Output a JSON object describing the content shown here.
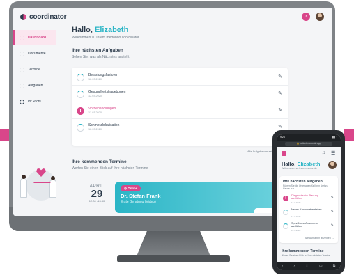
{
  "app": {
    "brand": "coordinator",
    "brand_accent": "#d9468a",
    "secondary_accent": "#2bb5c6",
    "notification_icon": "bell-icon"
  },
  "sidebar": {
    "items": [
      {
        "label": "Dashboard",
        "icon": "dashboard-icon",
        "active": true
      },
      {
        "label": "Dokumente",
        "icon": "document-icon",
        "active": false
      },
      {
        "label": "Termine",
        "icon": "calendar-icon",
        "active": false
      },
      {
        "label": "Aufgaben",
        "icon": "checklist-icon",
        "active": false
      },
      {
        "label": "Ihr Profil",
        "icon": "user-icon",
        "active": false
      }
    ]
  },
  "greeting": {
    "hello": "Hallo,",
    "name": "Elizabeth",
    "welcome": "Willkommen zu Ihrem medondo coordinator"
  },
  "tasks": {
    "title": "Ihre nächsten Aufgaben",
    "subtitle": "Sehen Sie, was als Nächstes ansteht",
    "items": [
      {
        "name": "Belastungsfaktoren",
        "date": "12.03.2020",
        "alert": false
      },
      {
        "name": "Gesundheitsfragebogen",
        "date": "12.03.2020",
        "alert": false
      },
      {
        "name": "Vorbehandlungen",
        "date": "12.03.2020",
        "alert": true
      },
      {
        "name": "Schmerzlokalisation",
        "date": "12.03.2020",
        "alert": false
      }
    ],
    "all_link": "Alle Aufgaben anzeigen"
  },
  "appointments": {
    "title": "Ihre kommenden Termine",
    "subtitle": "Werfen Sie einen Blick auf Ihre nächsten Termine",
    "month": "APRIL",
    "day": "29",
    "time": "12:00 -13:30",
    "badge": "Online",
    "doctor": "Dr. Stefan Frank",
    "type": "Erste Beratung (Video)"
  },
  "phone": {
    "time": "9:26",
    "url": "patient.medondo.app",
    "hello": "Hallo,",
    "name": "Elizabeth",
    "welcome": "Willkommen zu Ihrem medondo",
    "tasks_title": "Ihre nächsten Aufgaben",
    "tasks_subtitle": "Führen Sie die Unterlagen für Ihren Arzt zu Hause aus",
    "tasks": [
      {
        "name": "Diagnostische Planung ausfüllen",
        "date": "12.3.2020",
        "alert": true
      },
      {
        "name": "Neues Kennwort erstellen",
        "date": "12.3.2020",
        "alert": false
      },
      {
        "name": "Spezifische Anamnese ausfüllen",
        "date": "12.3.2020",
        "alert": false
      }
    ],
    "all_link": "Alle Aufgaben anzeigen",
    "appt_title": "Ihre kommenden Termine",
    "appt_subtitle": "Werfen Sie einen Blick auf Ihre nächsten Termine"
  }
}
